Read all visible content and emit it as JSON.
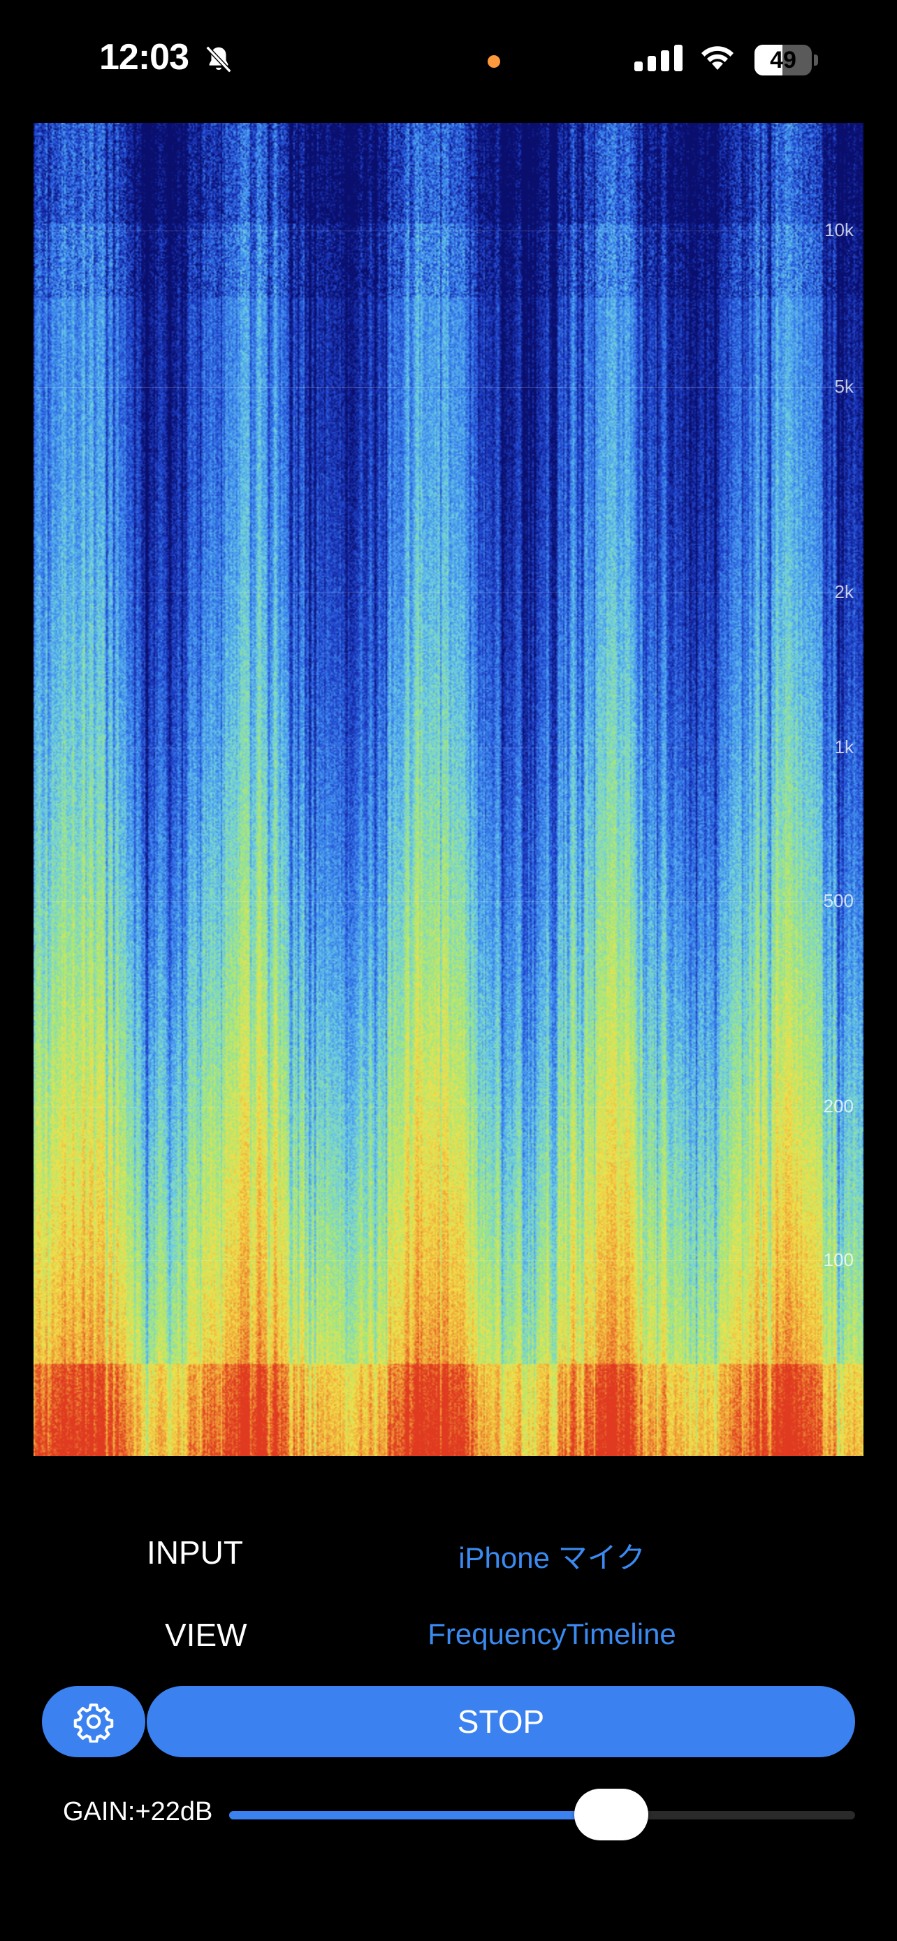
{
  "status_bar": {
    "time": "12:03",
    "battery_percent": "49",
    "battery_level": 0.49,
    "icons": [
      "bell-slash-icon",
      "cellular-signal-icon",
      "wifi-icon",
      "battery-icon"
    ],
    "indicator_color": "#ff9a3c"
  },
  "spectrogram": {
    "frequency_labels": [
      "10k",
      "5k",
      "2k",
      "1k",
      "500",
      "200",
      "100"
    ],
    "colormap": [
      "#0a0f6e",
      "#1e3fc8",
      "#3f8cf0",
      "#6fd0e0",
      "#a8e878",
      "#f2e14a",
      "#f0a038",
      "#e03a20"
    ]
  },
  "controls": {
    "input_label": "INPUT",
    "input_value": "iPhone マイク",
    "view_label": "VIEW",
    "view_value": "FrequencyTimeline",
    "settings_icon": "gear-icon",
    "stop_label": "STOP",
    "gain_label": "GAIN:+22dB",
    "gain_level": 0.61
  },
  "colors": {
    "accent": "#3b82f0",
    "link_text": "#3b8af0",
    "background": "#000000"
  }
}
